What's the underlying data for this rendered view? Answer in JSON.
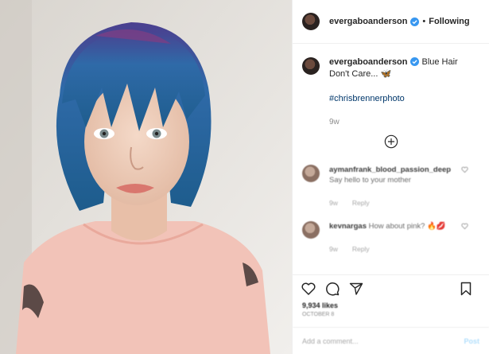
{
  "header": {
    "username": "evergaboanderson",
    "separator": "•",
    "follow_label": "Following"
  },
  "caption": {
    "username": "evergaboanderson",
    "text": "Blue Hair Don't Care... 🦋",
    "hashtag": "#chrisbrennerphoto",
    "time": "9w"
  },
  "comments": [
    {
      "username": "aymanfrank_blood_passion_deep",
      "text": "Say hello to your mother",
      "time": "9w",
      "reply": "Reply"
    },
    {
      "username": "kevnargas",
      "text": "How about pink? 🔥💋",
      "time": "9w",
      "reply": "Reply"
    }
  ],
  "likes": "9,934 likes",
  "date": "OCTOBER 8",
  "add_comment": {
    "placeholder": "Add a comment...",
    "post_label": "Post"
  },
  "colors": {
    "verified": "#3897f0",
    "link": "#00376b",
    "muted": "#8e8e8e"
  }
}
